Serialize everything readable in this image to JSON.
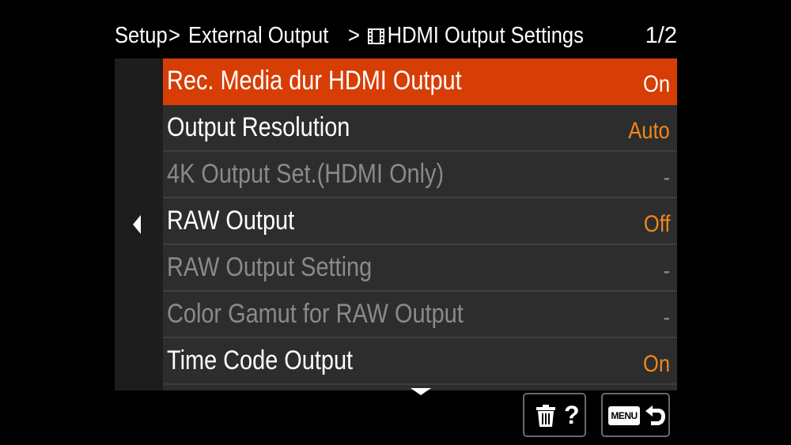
{
  "header": {
    "breadcrumb_root": "Setup",
    "separator_1": ">",
    "breadcrumb_section": "External Output",
    "separator_2": ">",
    "current_page_icon": "film-icon",
    "current_page": "HDMI Output Settings",
    "page_indicator": "1/2"
  },
  "menu": {
    "items": [
      {
        "label": "Rec. Media dur HDMI Output",
        "value": "On",
        "state": "selected"
      },
      {
        "label": "Output Resolution",
        "value": "Auto",
        "state": "enabled"
      },
      {
        "label": "4K Output Set.(HDMI Only)",
        "value": "-",
        "state": "disabled"
      },
      {
        "label": "RAW Output",
        "value": "Off",
        "state": "enabled"
      },
      {
        "label": "RAW Output Setting",
        "value": "-",
        "state": "disabled"
      },
      {
        "label": "Color Gamut for RAW Output",
        "value": "-",
        "state": "disabled"
      },
      {
        "label": "Time Code Output",
        "value": "On",
        "state": "enabled"
      }
    ]
  },
  "footer": {
    "delete_icon": "trash-icon",
    "help_label": "?",
    "menu_label": "MENU",
    "back_icon": "return-arrow-icon"
  },
  "colors": {
    "selected_background": "#d63e06",
    "value_text": "#f0871c",
    "disabled_text": "#8a8a8a",
    "list_background": "#2d2d2d"
  }
}
